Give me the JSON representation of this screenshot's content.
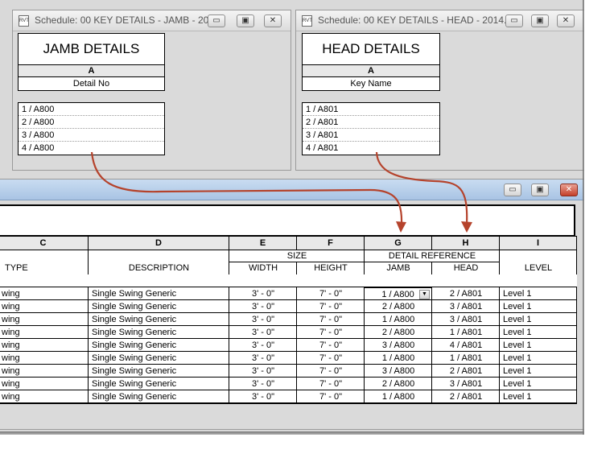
{
  "jamb_window": {
    "title": "Schedule: 00 KEY DETAILS - JAMB - 20...",
    "icon": "RVT",
    "schedule_title": "JAMB DETAILS",
    "column_letter": "A",
    "column_name": "Detail No",
    "rows": [
      "1 / A800",
      "2 / A800",
      "3 / A800",
      "4 / A800"
    ]
  },
  "head_window": {
    "title": "Schedule: 00 KEY DETAILS - HEAD - 2014...",
    "icon": "RVT",
    "schedule_title": "HEAD DETAILS",
    "column_letter": "A",
    "column_name": "Key Name",
    "rows": [
      "1 / A801",
      "2 / A801",
      "3 / A801",
      "4 / A801"
    ]
  },
  "window_controls": {
    "minimize": "▭",
    "restore": "▣",
    "close": "✕"
  },
  "main_schedule": {
    "column_letters": [
      "C",
      "D",
      "E",
      "F",
      "G",
      "H",
      "I"
    ],
    "group_headers": {
      "size": "SIZE",
      "detail_reference": "DETAIL REFERENCE"
    },
    "column_names": [
      "TYPE",
      "DESCRIPTION",
      "WIDTH",
      "HEIGHT",
      "JAMB",
      "HEAD",
      "LEVEL"
    ],
    "rows": [
      [
        "wing",
        "Single Swing Generic",
        "3' - 0\"",
        "7' - 0\"",
        "1 / A800",
        "2 / A801",
        "Level 1"
      ],
      [
        "wing",
        "Single Swing Generic",
        "3' - 0\"",
        "7' - 0\"",
        "2 / A800",
        "3 / A801",
        "Level 1"
      ],
      [
        "wing",
        "Single Swing Generic",
        "3' - 0\"",
        "7' - 0\"",
        "1 / A800",
        "3 / A801",
        "Level 1"
      ],
      [
        "wing",
        "Single Swing Generic",
        "3' - 0\"",
        "7' - 0\"",
        "2 / A800",
        "1 / A801",
        "Level 1"
      ],
      [
        "wing",
        "Single Swing Generic",
        "3' - 0\"",
        "7' - 0\"",
        "3 / A800",
        "4 / A801",
        "Level 1"
      ],
      [
        "wing",
        "Single Swing Generic",
        "3' - 0\"",
        "7' - 0\"",
        "1 / A800",
        "1 / A801",
        "Level 1"
      ],
      [
        "wing",
        "Single Swing Generic",
        "3' - 0\"",
        "7' - 0\"",
        "3 / A800",
        "2 / A801",
        "Level 1"
      ],
      [
        "wing",
        "Single Swing Generic",
        "3' - 0\"",
        "7' - 0\"",
        "2 / A800",
        "3 / A801",
        "Level 1"
      ],
      [
        "wing",
        "Single Swing Generic",
        "3' - 0\"",
        "7' - 0\"",
        "1 / A800",
        "2 / A801",
        "Level 1"
      ]
    ],
    "dropdown_icon": "▼"
  },
  "colors": {
    "arrow": "#b5432c",
    "close_button": "#c4402a"
  },
  "icons": [
    "revit-file-icon",
    "minimize-icon",
    "restore-icon",
    "close-icon",
    "chevron-down-icon",
    "curved-arrow-icon"
  ]
}
